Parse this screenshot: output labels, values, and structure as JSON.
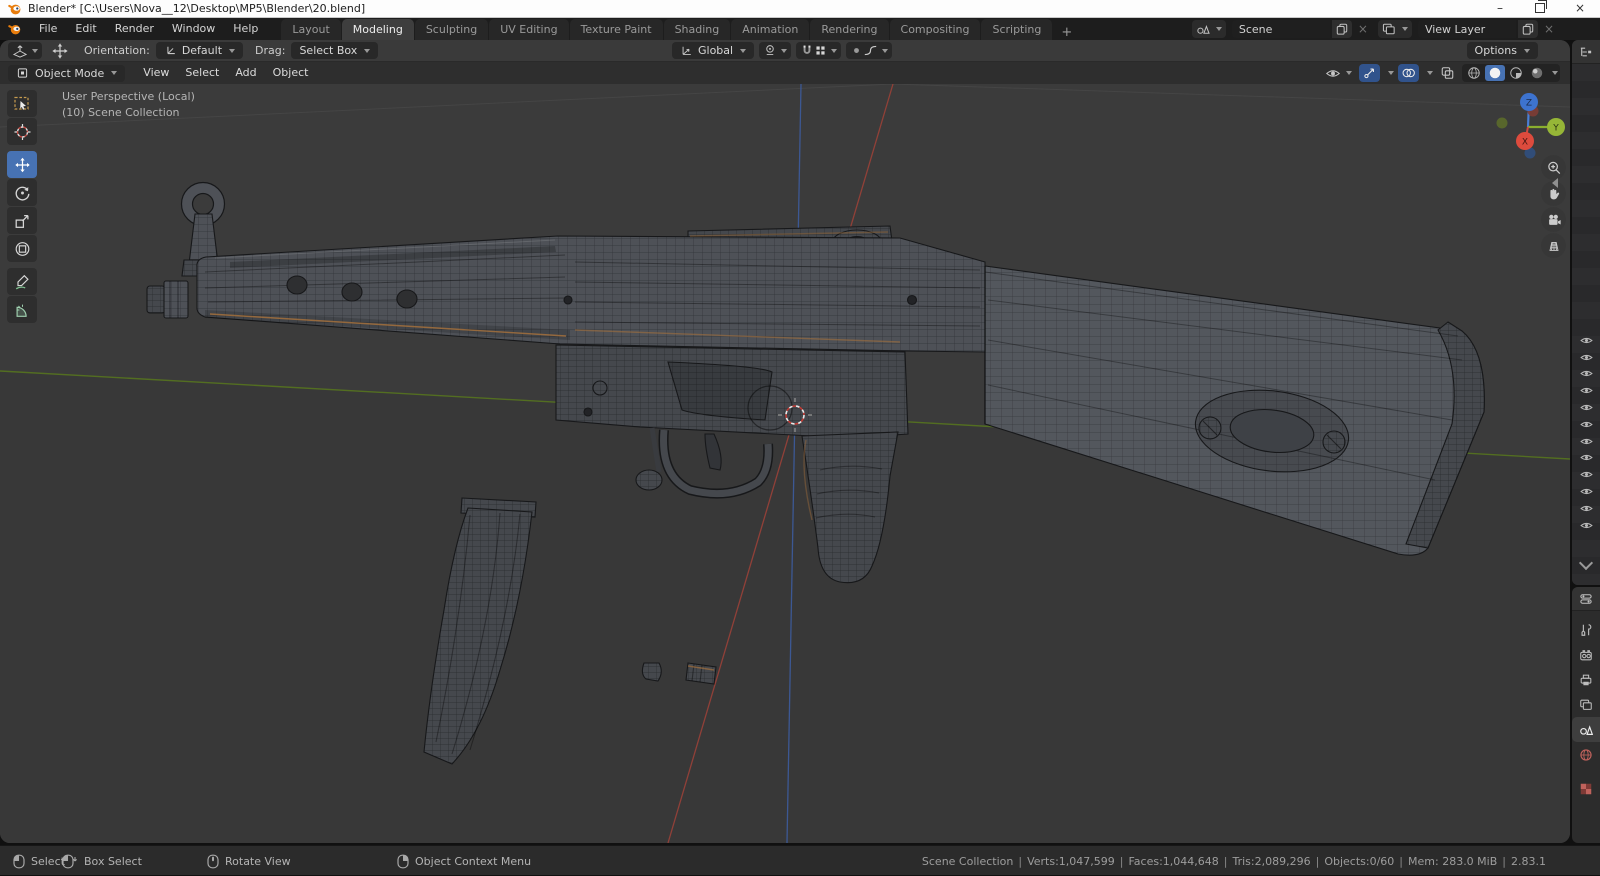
{
  "window": {
    "title": "Blender* [C:\\Users\\Nova__12\\Desktop\\MP5\\Blender\\20.blend]",
    "minimize": "–",
    "close": "×"
  },
  "topbar": {
    "menus": {
      "file": "File",
      "edit": "Edit",
      "render": "Render",
      "window": "Window",
      "help": "Help"
    },
    "workspaces": [
      "Layout",
      "Modeling",
      "Sculpting",
      "UV Editing",
      "Texture Paint",
      "Shading",
      "Animation",
      "Rendering",
      "Compositing",
      "Scripting"
    ],
    "active_workspace": "Modeling",
    "workspace_add": "+",
    "scene_value": "Scene",
    "view_layer_value": "View Layer"
  },
  "tool_settings": {
    "orientation_label": "Orientation:",
    "orientation_value": "Default",
    "drag_label": "Drag:",
    "drag_value": "Select Box",
    "transform_orientation": "Global",
    "options_label": "Options"
  },
  "viewport": {
    "mode": "Object Mode",
    "menus": [
      "View",
      "Select",
      "Add",
      "Object"
    ],
    "overlay_line1": "User Perspective (Local)",
    "overlay_line2": "(10) Scene Collection",
    "gizmo_axes": {
      "x": "X",
      "y": "Y",
      "z": "Z"
    }
  },
  "status_bar": {
    "hints": [
      {
        "icon": "left-mouse-icon",
        "label": "Select"
      },
      {
        "icon": "left-mouse-drag-icon",
        "label": "Box Select"
      },
      {
        "icon": "middle-mouse-icon",
        "label": "Rotate View"
      },
      {
        "icon": "right-mouse-icon",
        "label": "Object Context Menu"
      }
    ],
    "separator": "|",
    "stats": [
      "Scene Collection",
      "Verts:1,047,599",
      "Faces:1,044,648",
      "Tris:2,089,296",
      "Objects:0/60",
      "Mem: 283.0 MiB",
      "2.83.1"
    ]
  },
  "icons": {
    "blender-logo": "orange-swirl",
    "scene-selector": "cone-and-sphere",
    "view-layer-selector": "stacked-images",
    "copy-id": "duplicate-pages",
    "delete-x": "×",
    "dropdown": "caret-down",
    "snap-magnet": "magnet",
    "proportional-editing": "dot-in-square",
    "falloff-curve": "smooth-curve",
    "visibility-eye": "eye",
    "nav-buttons": [
      "zoom",
      "pan-hand",
      "camera-view",
      "orthographic-grid"
    ],
    "toolbar-tools": [
      "select-box",
      "cursor",
      "move",
      "rotate",
      "scale",
      "transform",
      "annotate",
      "measure"
    ],
    "properties-tabs": [
      "tool",
      "render",
      "output",
      "view-layer",
      "scene",
      "world",
      "texture"
    ]
  },
  "colors": {
    "accent_blue": "#4772b3",
    "axis_x": "#c8453c",
    "axis_y": "#7fa62e",
    "axis_z": "#3d6cc9",
    "viewport_bg": "#3b3b3b"
  }
}
